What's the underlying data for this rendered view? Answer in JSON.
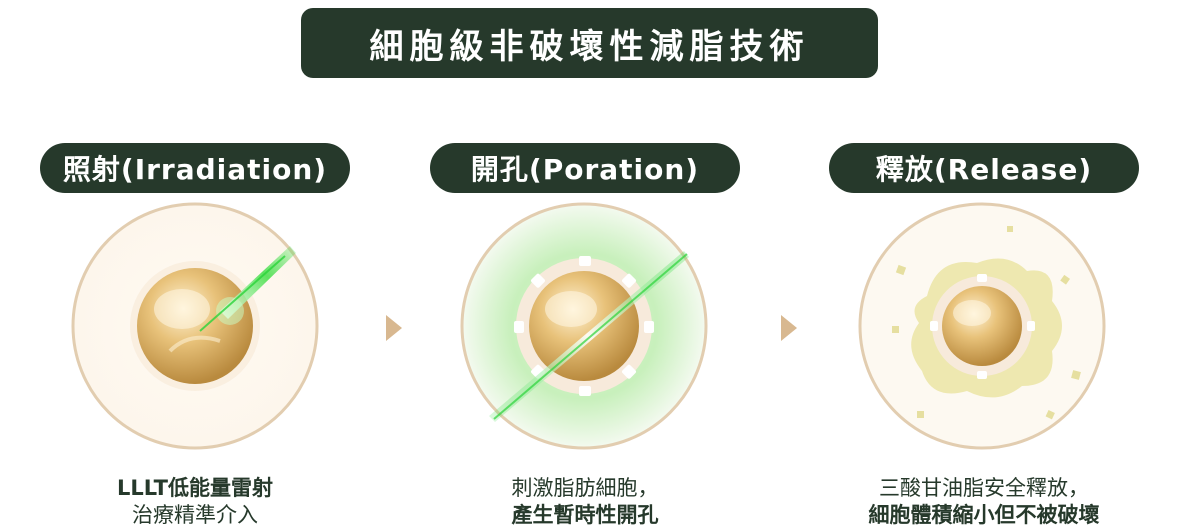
{
  "title": "細胞級非破壞性減脂技術",
  "stages": [
    {
      "label": "照射(Irradiation)",
      "caption_line1": "LLLT低能量雷射",
      "caption_line2": "治療精準介入"
    },
    {
      "label": "開孔(Poration)",
      "caption_line1": "刺激脂肪細胞，",
      "caption_line2": "產生暫時性開孔"
    },
    {
      "label": "釋放(Release)",
      "caption_line1": "三酸甘油脂安全釋放，",
      "caption_line2": "細胞體積縮小但不被破壞"
    }
  ],
  "colors": {
    "pill": "#26392b",
    "ring": "#e2cdb0",
    "cell_gold": "#d6a85a",
    "laser_green": "#3fdc4a",
    "fat_release": "#e8e0a0",
    "arrow": "#d8b890"
  },
  "icons": [
    "fat-cell-icon",
    "laser-beam-icon",
    "next-arrow-icon"
  ]
}
